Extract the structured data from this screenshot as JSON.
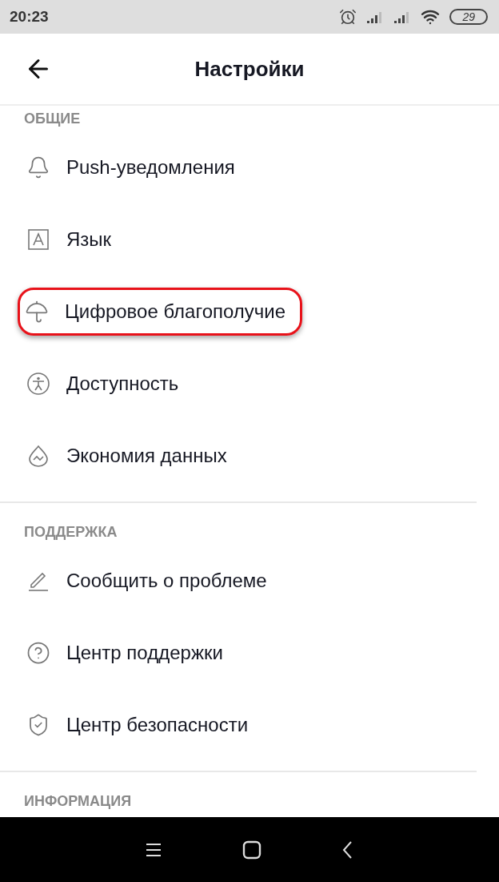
{
  "status_bar": {
    "time": "20:23",
    "battery": "29"
  },
  "header": {
    "title": "Настройки"
  },
  "sections": [
    {
      "title": "ОБЩИЕ",
      "items": [
        {
          "kind": "bell",
          "label": "Push-уведомления",
          "highlighted": false
        },
        {
          "kind": "letter",
          "label": "Язык",
          "highlighted": false
        },
        {
          "kind": "umbrella",
          "label": "Цифровое благополучие",
          "highlighted": true
        },
        {
          "kind": "accessibility",
          "label": "Доступность",
          "highlighted": false
        },
        {
          "kind": "drop",
          "label": "Экономия данных",
          "highlighted": false
        }
      ]
    },
    {
      "title": "ПОДДЕРЖКА",
      "items": [
        {
          "kind": "pencil",
          "label": "Сообщить о проблеме",
          "highlighted": false
        },
        {
          "kind": "help",
          "label": "Центр поддержки",
          "highlighted": false
        },
        {
          "kind": "shield",
          "label": "Центр безопасности",
          "highlighted": false
        }
      ]
    },
    {
      "title": "ИНФОРМАЦИЯ"
    }
  ]
}
